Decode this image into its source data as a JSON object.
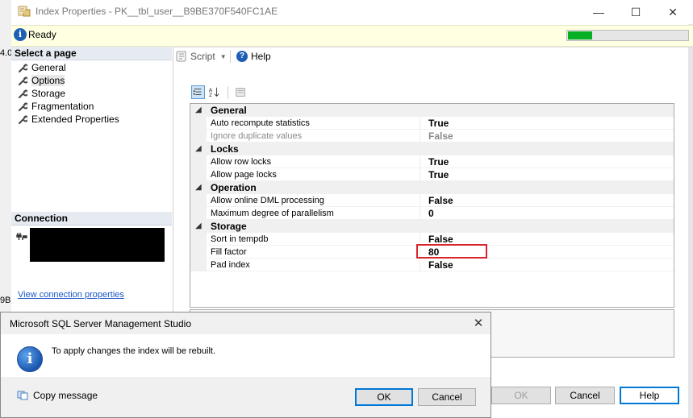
{
  "window": {
    "title": "Index Properties - PK__tbl_user__B9BE370F540FC1AE",
    "status": "Ready",
    "progress": 0.2
  },
  "background_fragments": [
    "4.0",
    "9B"
  ],
  "left_pane": {
    "select_header": "Select a page",
    "pages": [
      {
        "label": "General",
        "selected": false
      },
      {
        "label": "Options",
        "selected": true
      },
      {
        "label": "Storage",
        "selected": false
      },
      {
        "label": "Fragmentation",
        "selected": false
      },
      {
        "label": "Extended Properties",
        "selected": false
      }
    ],
    "connection_header": "Connection",
    "view_connection_link": "View connection properties"
  },
  "toolbar": {
    "script_label": "Script",
    "help_label": "Help"
  },
  "property_grid": {
    "rows": [
      {
        "type": "category",
        "name": "General"
      },
      {
        "type": "prop",
        "name": "Auto recompute statistics",
        "value": "True",
        "disabled": false
      },
      {
        "type": "prop",
        "name": "Ignore duplicate values",
        "value": "False",
        "disabled": true
      },
      {
        "type": "category",
        "name": "Locks"
      },
      {
        "type": "prop",
        "name": "Allow row locks",
        "value": "True",
        "disabled": false
      },
      {
        "type": "prop",
        "name": "Allow page locks",
        "value": "True",
        "disabled": false
      },
      {
        "type": "category",
        "name": "Operation"
      },
      {
        "type": "prop",
        "name": "Allow online DML processing",
        "value": "False",
        "disabled": false
      },
      {
        "type": "prop",
        "name": "Maximum degree of parallelism",
        "value": "0",
        "disabled": false
      },
      {
        "type": "category",
        "name": "Storage"
      },
      {
        "type": "prop",
        "name": "Sort in tempdb",
        "value": "False",
        "disabled": false
      },
      {
        "type": "prop",
        "name": "Fill factor",
        "value": "80",
        "disabled": false
      },
      {
        "type": "prop",
        "name": "Pad index",
        "value": "False",
        "disabled": false
      }
    ]
  },
  "footer_buttons": {
    "ok": "OK",
    "cancel": "Cancel",
    "help": "Help"
  },
  "dialog": {
    "title": "Microsoft SQL Server Management Studio",
    "message": "To apply changes the index will be rebuilt.",
    "copy_message": "Copy message",
    "ok": "OK",
    "cancel": "Cancel"
  },
  "colors": {
    "highlight_border": "#d9242c",
    "status_background": "#ffffe1",
    "progress_fill": "#06b025",
    "link": "#1a56c9",
    "primary_border": "#0078d7"
  }
}
